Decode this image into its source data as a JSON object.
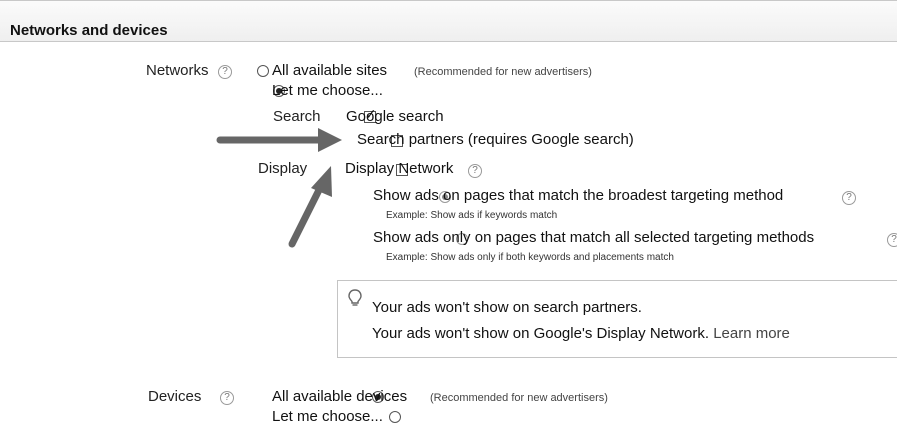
{
  "section": {
    "title": "Networks and devices"
  },
  "networks": {
    "label": "Networks",
    "help": "?",
    "all_sites": {
      "label": "All available sites",
      "note": "(Recommended for new advertisers)",
      "selected": false
    },
    "let_me_choose": {
      "label": "Let me choose...",
      "selected": true
    },
    "search": {
      "label": "Search",
      "google_search": {
        "label": "Google search",
        "checked": true
      },
      "search_partners": {
        "label": "Search partners (requires Google search)",
        "checked": false
      }
    },
    "display": {
      "label": "Display",
      "display_network": {
        "label": "Display Network",
        "checked": false
      },
      "help": "?",
      "broadest": {
        "label": "Show ads on pages that match the broadest targeting method",
        "example": "Example: Show ads if keywords match",
        "selected": true
      },
      "all_selected": {
        "label": "Show ads only on pages that match all selected targeting methods",
        "example": "Example: Show ads only if both keywords and placements match",
        "selected": false
      }
    },
    "info": {
      "line1": "Your ads won't show on search partners.",
      "line2": "Your ads won't show on Google's Display Network.",
      "learn_more": "Learn more"
    }
  },
  "devices": {
    "label": "Devices",
    "help": "?",
    "all_devices": {
      "label": "All available devices",
      "note": "(Recommended for new advertisers)",
      "selected": true
    },
    "let_me_choose": {
      "label": "Let me choose...",
      "selected": false
    }
  },
  "icons": {
    "help": "question-mark-circle-icon",
    "tip": "lightbulb-icon",
    "arrow": "annotation-arrow-icon"
  }
}
